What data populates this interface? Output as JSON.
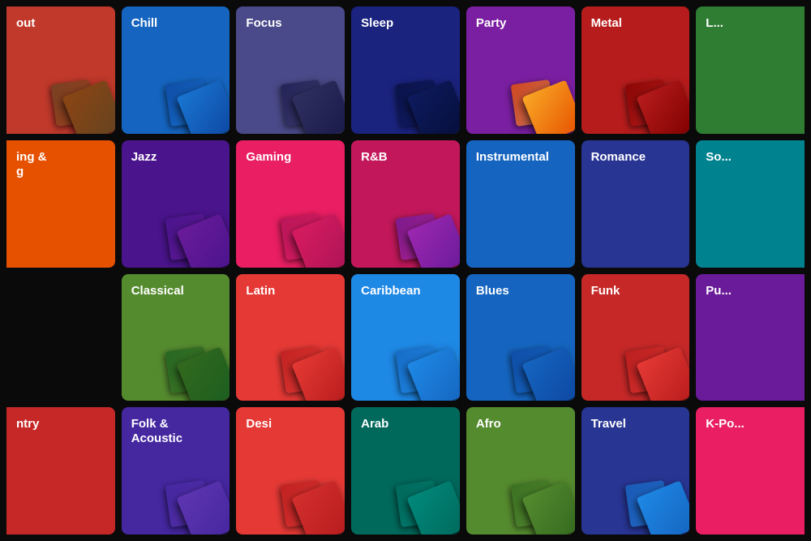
{
  "cards": [
    {
      "id": "out",
      "label": "out",
      "color": "#c0392b",
      "row": 0,
      "col": 0,
      "partial": "left"
    },
    {
      "id": "chill",
      "label": "Chill",
      "color": "#1565c0",
      "row": 0,
      "col": 1
    },
    {
      "id": "focus",
      "label": "Focus",
      "color": "#4a4a8a",
      "row": 0,
      "col": 2
    },
    {
      "id": "sleep",
      "label": "Sleep",
      "color": "#1a237e",
      "row": 0,
      "col": 3
    },
    {
      "id": "party",
      "label": "Party",
      "color": "#7b1fa2",
      "row": 0,
      "col": 4
    },
    {
      "id": "metal",
      "label": "Metal",
      "color": "#b71c1c",
      "row": 0,
      "col": 5
    },
    {
      "id": "le",
      "label": "L...",
      "color": "#2e7d32",
      "row": 0,
      "col": 6,
      "partial": "right"
    },
    {
      "id": "ing",
      "label": "ing &\ng",
      "color": "#e65100",
      "row": 1,
      "col": 0,
      "partial": "left"
    },
    {
      "id": "jazz",
      "label": "Jazz",
      "color": "#4a148c",
      "row": 1,
      "col": 1
    },
    {
      "id": "gaming",
      "label": "Gaming",
      "color": "#e91e63",
      "row": 1,
      "col": 2
    },
    {
      "id": "rnb",
      "label": "R&B",
      "color": "#c2185b",
      "row": 1,
      "col": 3
    },
    {
      "id": "instrumental",
      "label": "Instrumental",
      "color": "#1565c0",
      "row": 1,
      "col": 4
    },
    {
      "id": "romance",
      "label": "Romance",
      "color": "#283593",
      "row": 1,
      "col": 5
    },
    {
      "id": "so",
      "label": "So...",
      "color": "#00838f",
      "row": 1,
      "col": 6,
      "partial": "right"
    },
    {
      "id": "classical",
      "label": "Classical",
      "color": "#558b2f",
      "row": 2,
      "col": 1
    },
    {
      "id": "latin",
      "label": "Latin",
      "color": "#e53935",
      "row": 2,
      "col": 2
    },
    {
      "id": "caribbean",
      "label": "Caribbean",
      "color": "#1e88e5",
      "row": 2,
      "col": 3
    },
    {
      "id": "blues",
      "label": "Blues",
      "color": "#1565c0",
      "row": 2,
      "col": 4
    },
    {
      "id": "funk",
      "label": "Funk",
      "color": "#c62828",
      "row": 2,
      "col": 5
    },
    {
      "id": "pun",
      "label": "Pu...",
      "color": "#6a1b9a",
      "row": 2,
      "col": 6,
      "partial": "right"
    },
    {
      "id": "ntry",
      "label": "ntry",
      "color": "#c62828",
      "row": 3,
      "col": 0,
      "partial": "left"
    },
    {
      "id": "folk",
      "label": "Folk &\nAcoustic",
      "color": "#4527a0",
      "row": 3,
      "col": 1
    },
    {
      "id": "desi",
      "label": "Desi",
      "color": "#e53935",
      "row": 3,
      "col": 2
    },
    {
      "id": "arab",
      "label": "Arab",
      "color": "#00695c",
      "row": 3,
      "col": 3
    },
    {
      "id": "afro",
      "label": "Afro",
      "color": "#558b2f",
      "row": 3,
      "col": 4
    },
    {
      "id": "travel",
      "label": "Travel",
      "color": "#283593",
      "row": 3,
      "col": 5
    },
    {
      "id": "kpo",
      "label": "K-Po...",
      "color": "#e91e63",
      "row": 3,
      "col": 6,
      "partial": "right"
    }
  ],
  "artColors": {
    "out": [
      "#8B4513",
      "#654321"
    ],
    "chill": [
      "#1976d2",
      "#0d47a1"
    ],
    "focus": [
      "#303060",
      "#1a1a4a"
    ],
    "sleep": [
      "#0d1b5e",
      "#060e3a"
    ],
    "party": [
      "#f9a825",
      "#e65100"
    ],
    "metal": [
      "#b71c1c",
      "#7f0000"
    ],
    "classical": [
      "#33691e",
      "#1b5e20"
    ],
    "latin": [
      "#e53935",
      "#b71c1c"
    ],
    "caribbean": [
      "#1e88e5",
      "#1565c0"
    ],
    "blues": [
      "#1565c0",
      "#0d47a1"
    ],
    "funk": [
      "#e53935",
      "#b71c1c"
    ],
    "jazz": [
      "#6a1b9a",
      "#4a148c"
    ],
    "gaming": [
      "#d81b60",
      "#ad1457"
    ],
    "rnb": [
      "#9c27b0",
      "#6a1b9a"
    ],
    "folk": [
      "#5e35b1",
      "#4527a0"
    ],
    "desi": [
      "#d32f2f",
      "#b71c1c"
    ],
    "arab": [
      "#00897b",
      "#00695c"
    ],
    "afro": [
      "#558b2f",
      "#33691e"
    ],
    "travel": [
      "#1e88e5",
      "#1565c0"
    ]
  }
}
